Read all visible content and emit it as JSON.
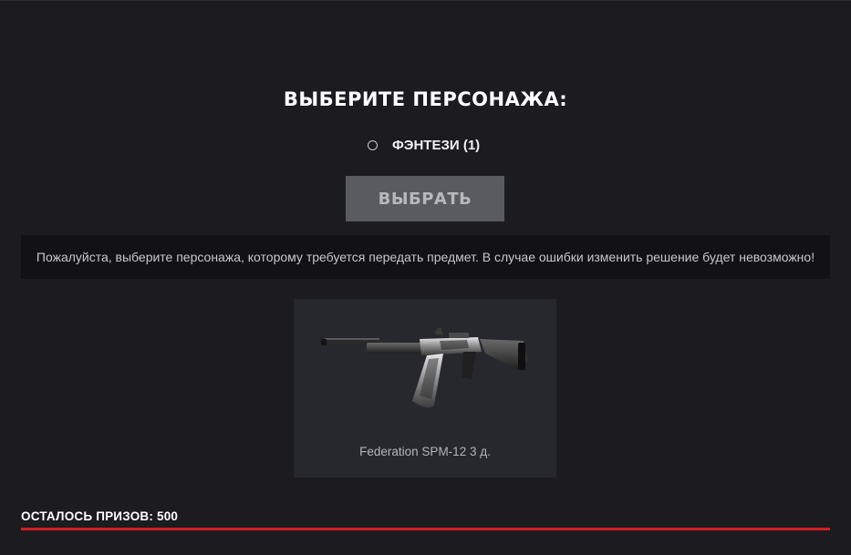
{
  "page": {
    "heading": "ВЫБЕРИТЕ ПЕРСОНАЖА:"
  },
  "characters": [
    {
      "label": "ФЭНТЕЗИ (1)",
      "selected": false
    }
  ],
  "select_button": {
    "label": "ВЫБРАТЬ",
    "enabled": false
  },
  "notice": "Пожалуйста, выберите персонажа, которому требуется передать предмет. В случае ошибки изменить решение будет невозможно!",
  "prize": {
    "name": "Federation SPM-12 3 д.",
    "image_icon": "shotgun-icon"
  },
  "footer": {
    "remaining_label": "ОСТАЛОСЬ ПРИЗОВ: 500"
  },
  "colors": {
    "background": "#1b1b20",
    "accent": "#d31e23",
    "button_disabled": "#595b60",
    "card": "#27272e",
    "notice_bg": "#121216"
  }
}
